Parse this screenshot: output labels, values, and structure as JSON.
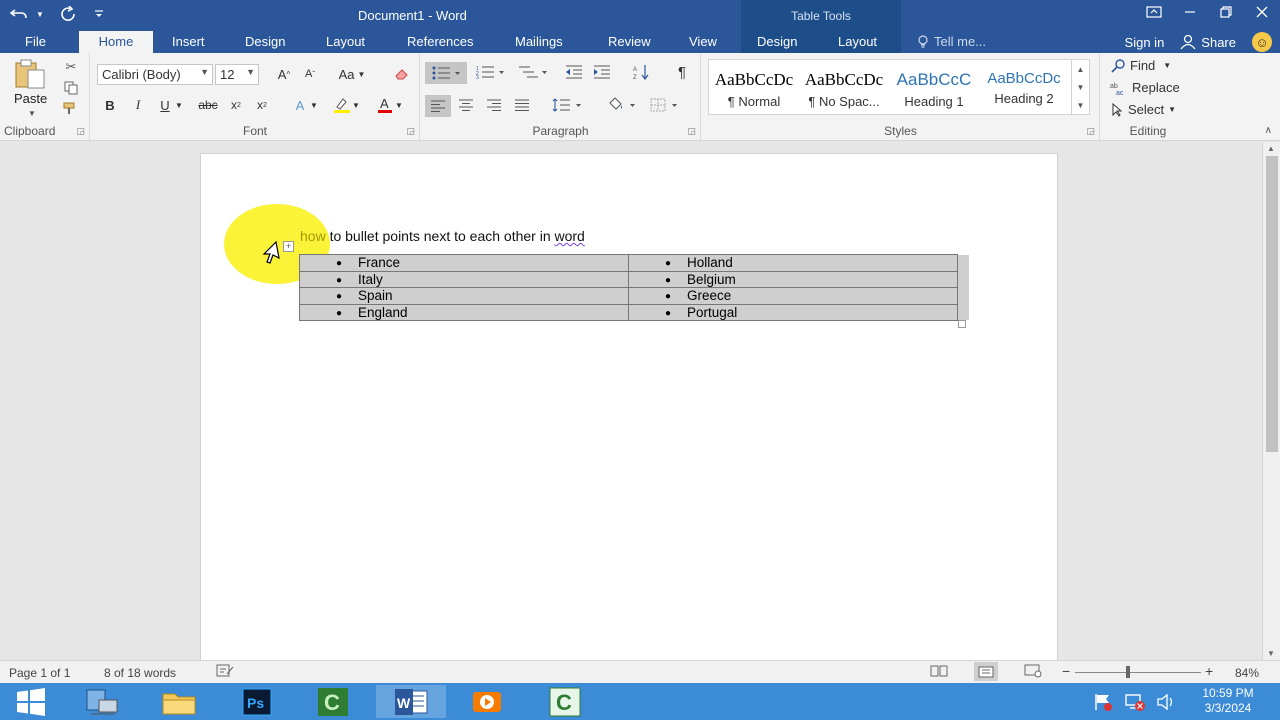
{
  "titlebar": {
    "doc_title": "Document1 - Word",
    "context_tools": "Table Tools"
  },
  "tabs": [
    "File",
    "Home",
    "Insert",
    "Design",
    "Layout",
    "References",
    "Mailings",
    "Review",
    "View",
    "Design",
    "Layout"
  ],
  "active_tab": "Home",
  "tell_me": "Tell me...",
  "sign_in": "Sign in",
  "share": "Share",
  "ribbon": {
    "clipboard": {
      "paste": "Paste",
      "label": "Clipboard"
    },
    "font": {
      "name": "Calibri (Body)",
      "size": "12",
      "label": "Font",
      "case": "Aa"
    },
    "paragraph": {
      "label": "Paragraph"
    },
    "styles": {
      "label": "Styles",
      "items": [
        {
          "sample": "AaBbCcDc",
          "name": "¶ Normal",
          "color": "#000000"
        },
        {
          "sample": "AaBbCcDc",
          "name": "¶ No Spac...",
          "color": "#000000"
        },
        {
          "sample": "AaBbCcC",
          "name": "Heading 1",
          "color": "#2e74b5"
        },
        {
          "sample": "AaBbCcDc",
          "name": "Heading 2",
          "color": "#2e74b5"
        }
      ]
    },
    "editing": {
      "label": "Editing",
      "find": "Find",
      "replace": "Replace",
      "select": "Select"
    }
  },
  "document": {
    "line_highlight_part": "how",
    "line_rest": " to bullet points next to each other in ",
    "line_squiggle": "word",
    "table": {
      "left": [
        "France",
        "Italy",
        "Spain",
        "England"
      ],
      "right": [
        "Holland",
        "Belgium",
        "Greece",
        "Portugal"
      ]
    }
  },
  "status": {
    "page": "Page 1 of 1",
    "words": "8 of 18 words",
    "zoom": "84%"
  },
  "clock": {
    "time": "10:59 PM",
    "date": "3/3/2024"
  },
  "colors": {
    "word_blue": "#2b579a",
    "taskbar": "#3c8bd6",
    "highlight": "#faf000"
  }
}
